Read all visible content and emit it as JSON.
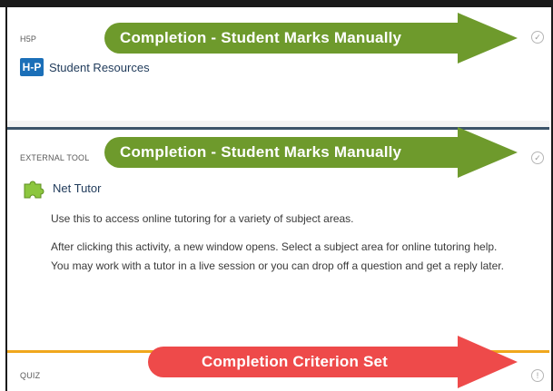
{
  "cards": [
    {
      "type_label": "H5P",
      "title": "Student Resources",
      "logo_text": "H-P",
      "annotation": "Completion - Student Marks Manually",
      "status_icon": "check-circle-icon"
    },
    {
      "type_label": "EXTERNAL TOOL",
      "title": "Net Tutor",
      "annotation": "Completion - Student Marks Manually",
      "description_1": "Use this to access online tutoring for a variety of subject areas.",
      "description_2": "After clicking this activity, a new window opens.  Select a subject area for online tutoring help.  You may work with a tutor in a live session or you can drop off a question and get a reply later.",
      "status_icon": "check-circle-icon"
    },
    {
      "type_label": "QUIZ",
      "annotation": "Completion Criterion Set",
      "status_icon": "info-circle-icon"
    }
  ],
  "colors": {
    "green_arrow": "#6e9a2c",
    "red_arrow": "#ee4a4a",
    "card2_top_border": "#3c5469",
    "card3_top_border": "#f0a71d",
    "link": "#1f3a5a"
  }
}
